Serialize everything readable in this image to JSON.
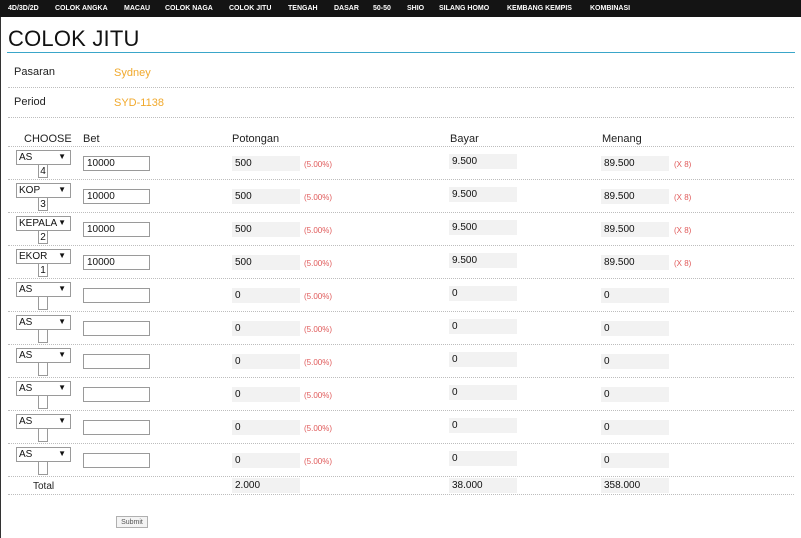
{
  "nav": [
    "4D/3D/2D",
    "COLOK ANGKA",
    "MACAU",
    "COLOK NAGA",
    "COLOK JITU",
    "TENGAH",
    "DASAR",
    "50-50",
    "SHIO",
    "SILANG HOMO",
    "KEMBANG KEMPIS",
    "KOMBINASI"
  ],
  "page_title": "COLOK JITU",
  "info": {
    "pasaran_label": "Pasaran",
    "pasaran_value": "Sydney",
    "period_label": "Period",
    "period_value": "SYD-1138"
  },
  "headers": {
    "choose": "CHOOSE",
    "bet": "Bet",
    "potongan": "Potongan",
    "bayar": "Bayar",
    "menang": "Menang"
  },
  "rows": [
    {
      "choose": "AS",
      "digit": "4",
      "bet": "10000",
      "potongan": "500",
      "pct": "(5.00%)",
      "bayar": "9.500",
      "menang": "89.500",
      "mult": "(X 8)"
    },
    {
      "choose": "KOP",
      "digit": "3",
      "bet": "10000",
      "potongan": "500",
      "pct": "(5.00%)",
      "bayar": "9.500",
      "menang": "89.500",
      "mult": "(X 8)"
    },
    {
      "choose": "KEPALA",
      "digit": "2",
      "bet": "10000",
      "potongan": "500",
      "pct": "(5.00%)",
      "bayar": "9.500",
      "menang": "89.500",
      "mult": "(X 8)"
    },
    {
      "choose": "EKOR",
      "digit": "1",
      "bet": "10000",
      "potongan": "500",
      "pct": "(5.00%)",
      "bayar": "9.500",
      "menang": "89.500",
      "mult": "(X 8)"
    },
    {
      "choose": "AS",
      "digit": "",
      "bet": "",
      "potongan": "0",
      "pct": "(5.00%)",
      "bayar": "0",
      "menang": "0",
      "mult": ""
    },
    {
      "choose": "AS",
      "digit": "",
      "bet": "",
      "potongan": "0",
      "pct": "(5.00%)",
      "bayar": "0",
      "menang": "0",
      "mult": ""
    },
    {
      "choose": "AS",
      "digit": "",
      "bet": "",
      "potongan": "0",
      "pct": "(5.00%)",
      "bayar": "0",
      "menang": "0",
      "mult": ""
    },
    {
      "choose": "AS",
      "digit": "",
      "bet": "",
      "potongan": "0",
      "pct": "(5.00%)",
      "bayar": "0",
      "menang": "0",
      "mult": ""
    },
    {
      "choose": "AS",
      "digit": "",
      "bet": "",
      "potongan": "0",
      "pct": "(5.00%)",
      "bayar": "0",
      "menang": "0",
      "mult": ""
    },
    {
      "choose": "AS",
      "digit": "",
      "bet": "",
      "potongan": "0",
      "pct": "(5.00%)",
      "bayar": "0",
      "menang": "0",
      "mult": ""
    }
  ],
  "totals": {
    "label": "Total",
    "potongan": "2.000",
    "bayar": "38.000",
    "menang": "358.000"
  },
  "submit_label": "Submit",
  "icons": {
    "select_arrow": "dropdown-arrow-icon"
  },
  "colors": {
    "nav_bg": "#141414",
    "accent": "#f1a92c",
    "title_rule": "#3aa6c9",
    "note": "#e05a5a"
  }
}
